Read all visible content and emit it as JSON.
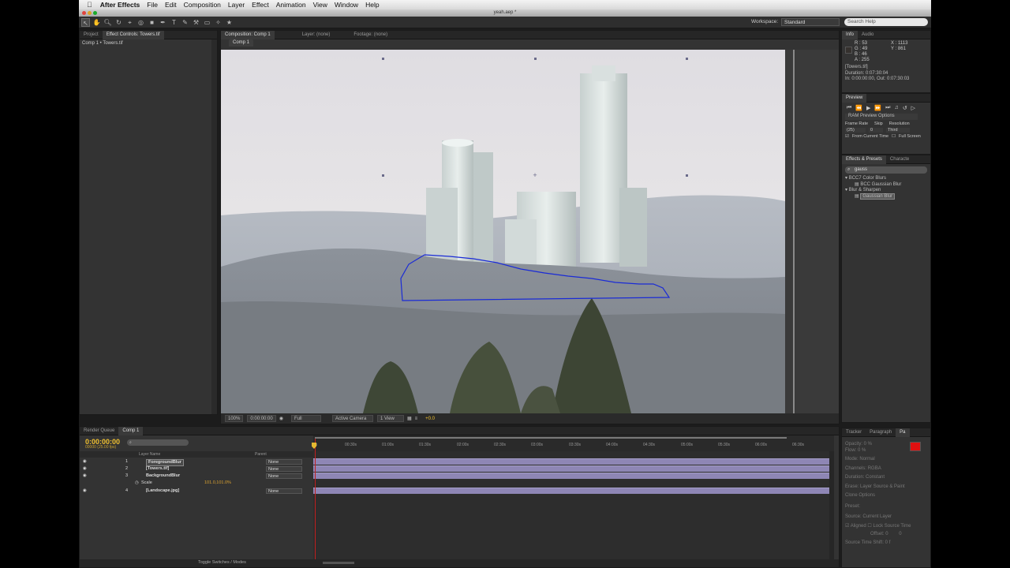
{
  "menubar": {
    "app": "After Effects",
    "items": [
      "File",
      "Edit",
      "Composition",
      "Layer",
      "Effect",
      "Animation",
      "View",
      "Window",
      "Help"
    ]
  },
  "window": {
    "title": "yeah.aep *"
  },
  "toolbar": {
    "workspace_label": "Workspace:",
    "workspace_value": "Standard",
    "search_placeholder": "Search Help"
  },
  "left_panel": {
    "tabs": [
      "Project",
      "Effect Controls: Towers.tif"
    ],
    "subhead": "Comp 1 • Towers.tif"
  },
  "comp_panel": {
    "tabs": [
      "Composition: Comp 1",
      "Layer: (none)",
      "Footage: (none)"
    ],
    "subtab": "Comp 1",
    "zoom": "100%",
    "timecode": "0:00:00:00",
    "resolution": "Full",
    "camera": "Active Camera",
    "views": "1 View",
    "exposure": "+0.0"
  },
  "info_panel": {
    "tabs": [
      "Info",
      "Audio"
    ],
    "r": "R : 53",
    "g": "G : 49",
    "b": "B : 46",
    "a": "A : 255",
    "x": "X : 1113",
    "y": "Y : 861",
    "file": "[Towers.tif]",
    "duration": "Duration: 0:07:30:04",
    "inout": "In: 0:00:00:00, Out: 0:07:30:03"
  },
  "preview_panel": {
    "title": "Preview",
    "ram_options": "RAM Preview Options",
    "frame_rate_label": "Frame Rate",
    "skip_label": "Skip",
    "resolution_label": "Resolution",
    "frame_rate": "(25)",
    "skip": "0",
    "resolution": "Third",
    "from_current": "From Current Time",
    "full_screen": "Full Screen"
  },
  "effects_panel": {
    "tabs": [
      "Effects & Presets",
      "Characte"
    ],
    "search": "gauss",
    "cat1": "BCC7 Color Blurs",
    "item1": "BCC Gaussian Blur",
    "cat2": "Blur & Sharpen",
    "item2": "Gaussian Blur"
  },
  "paint_panel": {
    "tabs": [
      "Tracker",
      "Paragraph",
      "Pa"
    ],
    "opacity": "Opacity: 0 %",
    "flow": "Flow: 0 %",
    "mode_label": "Mode:",
    "mode": "Normal",
    "channels_label": "Channels:",
    "channels": "RGBA",
    "duration_label": "Duration:",
    "duration": "Constant",
    "erase_label": "Erase:",
    "erase": "Layer Source & Paint",
    "clone_options": "Clone Options",
    "preset_label": "Preset:",
    "source_label": "Source:",
    "source": "Current Layer",
    "aligned": "Aligned",
    "lock_source": "Lock Source Time",
    "offset": "Offset: 0",
    "offset_y": "0",
    "shift": "Source Time Shift: 0  f",
    "color": "#e01010"
  },
  "timeline": {
    "tabs": [
      "Render Queue",
      "Comp 1"
    ],
    "timecode": "0:00:00:00",
    "fps": "00000 (25.00 fps)",
    "col_layer": "Layer Name",
    "col_parent": "Parent",
    "ticks": [
      "0s",
      "00:30s",
      "01:00s",
      "01:30s",
      "02:00s",
      "02:30s",
      "03:00s",
      "03:30s",
      "04:00s",
      "04:30s",
      "05:00s",
      "05:30s",
      "06:00s",
      "06:30s"
    ],
    "layers": [
      {
        "num": "1",
        "name": "ForegroundBlur",
        "parent": "None"
      },
      {
        "num": "2",
        "name": "[Towers.tif]",
        "parent": "None"
      },
      {
        "num": "3",
        "name": "BackgroundBlur",
        "parent": "None"
      },
      {
        "num": "4",
        "name": "[Landscape.jpg]",
        "parent": "None"
      }
    ],
    "scale_label": "Scale",
    "scale_value": "101.0,101.0%",
    "toggle": "Toggle Switches / Modes"
  }
}
